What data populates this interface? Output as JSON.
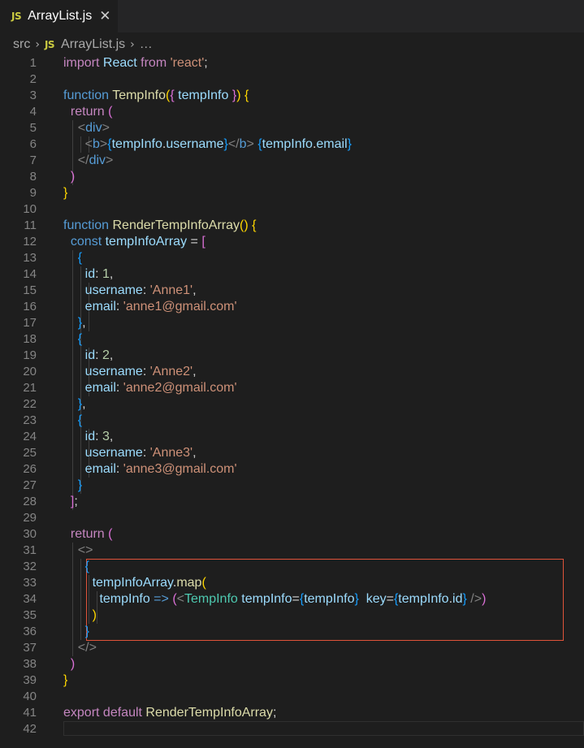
{
  "tab": {
    "icon_text": "JS",
    "title": "ArrayList.js",
    "close_glyph": "✕"
  },
  "breadcrumb": {
    "folder": "src",
    "sep": "›",
    "file_icon_text": "JS",
    "file": "ArrayList.js",
    "more": "…"
  },
  "lines": [
    [
      [
        "k",
        "import"
      ],
      [
        "p",
        " "
      ],
      [
        "v",
        "React"
      ],
      [
        "p",
        " "
      ],
      [
        "k",
        "from"
      ],
      [
        "p",
        " "
      ],
      [
        "s",
        "'react'"
      ],
      [
        "p",
        ";"
      ]
    ],
    [],
    [
      [
        "kb",
        "function"
      ],
      [
        "p",
        " "
      ],
      [
        "f",
        "TempInfo"
      ],
      [
        "b1",
        "("
      ],
      [
        "b2",
        "{"
      ],
      [
        "p",
        " "
      ],
      [
        "v",
        "tempInfo"
      ],
      [
        "p",
        " "
      ],
      [
        "b2",
        "}"
      ],
      [
        "b1",
        ")"
      ],
      [
        "p",
        " "
      ],
      [
        "b1",
        "{"
      ]
    ],
    [
      [
        "p",
        "  "
      ],
      [
        "k",
        "return"
      ],
      [
        "p",
        " "
      ],
      [
        "b2",
        "("
      ]
    ],
    [
      [
        "p",
        "    "
      ],
      [
        "tg",
        "<"
      ],
      [
        "t",
        "div"
      ],
      [
        "tg",
        ">"
      ]
    ],
    [
      [
        "p",
        "      "
      ],
      [
        "tg",
        "<"
      ],
      [
        "t",
        "b"
      ],
      [
        "tg",
        ">"
      ],
      [
        "b3",
        "{"
      ],
      [
        "v",
        "tempInfo"
      ],
      [
        "p",
        "."
      ],
      [
        "v",
        "username"
      ],
      [
        "b3",
        "}"
      ],
      [
        "tg",
        "</"
      ],
      [
        "t",
        "b"
      ],
      [
        "tg",
        ">"
      ],
      [
        "p",
        " "
      ],
      [
        "b3",
        "{"
      ],
      [
        "v",
        "tempInfo"
      ],
      [
        "p",
        "."
      ],
      [
        "v",
        "email"
      ],
      [
        "b3",
        "}"
      ]
    ],
    [
      [
        "p",
        "    "
      ],
      [
        "tg",
        "</"
      ],
      [
        "t",
        "div"
      ],
      [
        "tg",
        ">"
      ]
    ],
    [
      [
        "p",
        "  "
      ],
      [
        "b2",
        ")"
      ]
    ],
    [
      [
        "b1",
        "}"
      ]
    ],
    [],
    [
      [
        "kb",
        "function"
      ],
      [
        "p",
        " "
      ],
      [
        "f",
        "RenderTempInfoArray"
      ],
      [
        "b1",
        "()"
      ],
      [
        "p",
        " "
      ],
      [
        "b1",
        "{"
      ]
    ],
    [
      [
        "p",
        "  "
      ],
      [
        "kb",
        "const"
      ],
      [
        "p",
        " "
      ],
      [
        "v",
        "tempInfoArray"
      ],
      [
        "p",
        " = "
      ],
      [
        "b2",
        "["
      ]
    ],
    [
      [
        "p",
        "    "
      ],
      [
        "b3",
        "{"
      ]
    ],
    [
      [
        "p",
        "      "
      ],
      [
        "v",
        "id"
      ],
      [
        "p",
        ": "
      ],
      [
        "n",
        "1"
      ],
      [
        "p",
        ","
      ]
    ],
    [
      [
        "p",
        "      "
      ],
      [
        "v",
        "username"
      ],
      [
        "p",
        ": "
      ],
      [
        "s",
        "'Anne1'"
      ],
      [
        "p",
        ","
      ]
    ],
    [
      [
        "p",
        "      "
      ],
      [
        "v",
        "email"
      ],
      [
        "p",
        ": "
      ],
      [
        "s",
        "'anne1@gmail.com'"
      ]
    ],
    [
      [
        "p",
        "    "
      ],
      [
        "b3",
        "}"
      ],
      [
        "p",
        ","
      ]
    ],
    [
      [
        "p",
        "    "
      ],
      [
        "b3",
        "{"
      ]
    ],
    [
      [
        "p",
        "      "
      ],
      [
        "v",
        "id"
      ],
      [
        "p",
        ": "
      ],
      [
        "n",
        "2"
      ],
      [
        "p",
        ","
      ]
    ],
    [
      [
        "p",
        "      "
      ],
      [
        "v",
        "username"
      ],
      [
        "p",
        ": "
      ],
      [
        "s",
        "'Anne2'"
      ],
      [
        "p",
        ","
      ]
    ],
    [
      [
        "p",
        "      "
      ],
      [
        "v",
        "email"
      ],
      [
        "p",
        ": "
      ],
      [
        "s",
        "'anne2@gmail.com'"
      ]
    ],
    [
      [
        "p",
        "    "
      ],
      [
        "b3",
        "}"
      ],
      [
        "p",
        ","
      ]
    ],
    [
      [
        "p",
        "    "
      ],
      [
        "b3",
        "{"
      ]
    ],
    [
      [
        "p",
        "      "
      ],
      [
        "v",
        "id"
      ],
      [
        "p",
        ": "
      ],
      [
        "n",
        "3"
      ],
      [
        "p",
        ","
      ]
    ],
    [
      [
        "p",
        "      "
      ],
      [
        "v",
        "username"
      ],
      [
        "p",
        ": "
      ],
      [
        "s",
        "'Anne3'"
      ],
      [
        "p",
        ","
      ]
    ],
    [
      [
        "p",
        "      "
      ],
      [
        "v",
        "email"
      ],
      [
        "p",
        ": "
      ],
      [
        "s",
        "'anne3@gmail.com'"
      ]
    ],
    [
      [
        "p",
        "    "
      ],
      [
        "b3",
        "}"
      ]
    ],
    [
      [
        "p",
        "  "
      ],
      [
        "b2",
        "]"
      ],
      [
        "p",
        ";"
      ]
    ],
    [],
    [
      [
        "p",
        "  "
      ],
      [
        "k",
        "return"
      ],
      [
        "p",
        " "
      ],
      [
        "b2",
        "("
      ]
    ],
    [
      [
        "p",
        "    "
      ],
      [
        "tg",
        "<>"
      ]
    ],
    [
      [
        "p",
        "      "
      ],
      [
        "b3",
        "{"
      ]
    ],
    [
      [
        "p",
        "        "
      ],
      [
        "v",
        "tempInfoArray"
      ],
      [
        "p",
        "."
      ],
      [
        "f",
        "map"
      ],
      [
        "b1",
        "("
      ]
    ],
    [
      [
        "p",
        "          "
      ],
      [
        "v",
        "tempInfo"
      ],
      [
        "p",
        " "
      ],
      [
        "kb",
        "=>"
      ],
      [
        "p",
        " "
      ],
      [
        "b2",
        "("
      ],
      [
        "tg",
        "<"
      ],
      [
        "c",
        "TempInfo"
      ],
      [
        "p",
        " "
      ],
      [
        "v",
        "tempInfo"
      ],
      [
        "p",
        "="
      ],
      [
        "b3",
        "{"
      ],
      [
        "v",
        "tempInfo"
      ],
      [
        "b3",
        "}"
      ],
      [
        "p",
        "  "
      ],
      [
        "v",
        "key"
      ],
      [
        "p",
        "="
      ],
      [
        "b3",
        "{"
      ],
      [
        "v",
        "tempInfo"
      ],
      [
        "p",
        "."
      ],
      [
        "v",
        "id"
      ],
      [
        "b3",
        "}"
      ],
      [
        "p",
        " "
      ],
      [
        "tg",
        "/>"
      ],
      [
        "b2",
        ")"
      ]
    ],
    [
      [
        "p",
        "        "
      ],
      [
        "b1",
        ")"
      ]
    ],
    [
      [
        "p",
        "      "
      ],
      [
        "b3",
        "}"
      ]
    ],
    [
      [
        "p",
        "    "
      ],
      [
        "tg",
        "</>"
      ]
    ],
    [
      [
        "p",
        "  "
      ],
      [
        "b2",
        ")"
      ]
    ],
    [
      [
        "b1",
        "}"
      ]
    ],
    [],
    [
      [
        "k",
        "export"
      ],
      [
        "p",
        " "
      ],
      [
        "k",
        "default"
      ],
      [
        "p",
        " "
      ],
      [
        "f",
        "RenderTempInfoArray"
      ],
      [
        "p",
        ";"
      ]
    ],
    []
  ]
}
